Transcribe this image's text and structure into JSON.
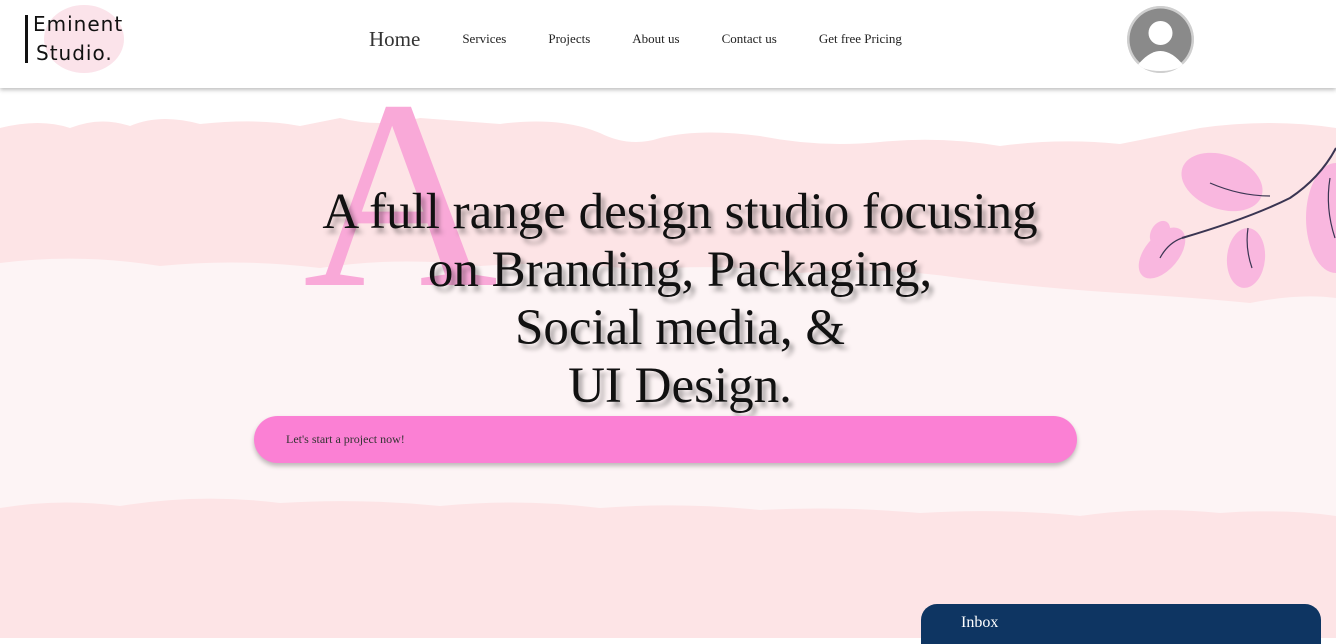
{
  "logo": {
    "line1": "Eminent",
    "line2": "Studio."
  },
  "nav": {
    "home": "Home",
    "services": "Services",
    "projects": "Projects",
    "about": "About us",
    "contact": "Contact us",
    "pricing": "Get free Pricing"
  },
  "avatar_icon": "user-avatar-icon",
  "hero": {
    "big_letter": "A",
    "headline": [
      "A full range design studio focusing",
      "on Branding, Packaging,",
      "Social media, &",
      "UI Design."
    ],
    "cta_label": "Let's start a project now!"
  },
  "inbox": {
    "label": "Inbox"
  },
  "colors": {
    "accent_pink": "#fb80d4",
    "letter_pink": "#f9a9d8",
    "paper_pink": "#fde4e6",
    "inbox_navy": "#0e3562"
  }
}
